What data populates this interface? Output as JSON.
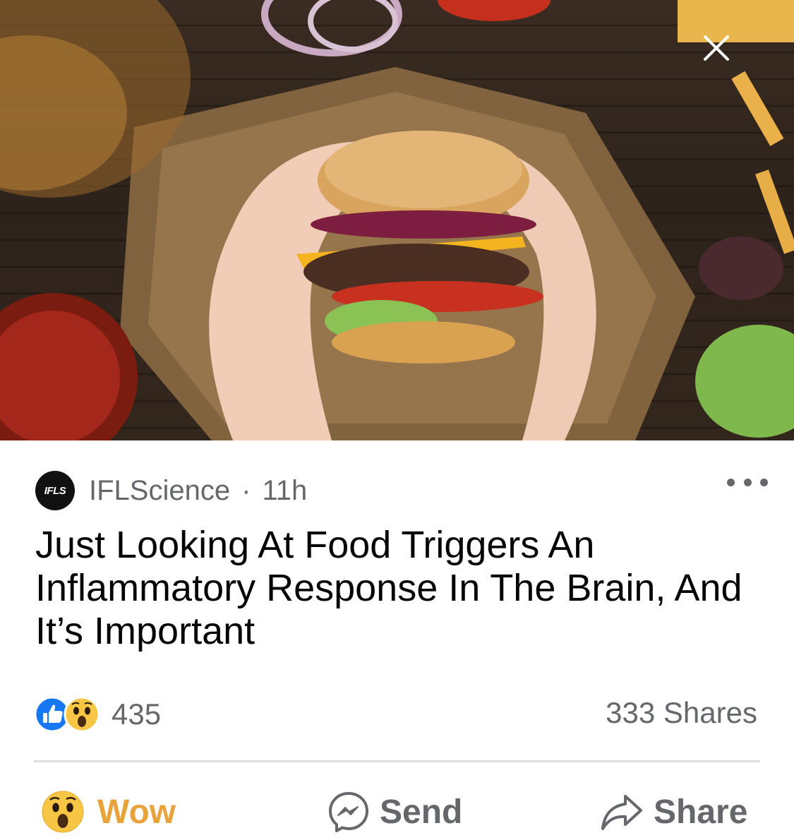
{
  "image": {
    "description": "",
    "close_icon": "close-icon"
  },
  "post": {
    "source_logo_text": "IFLS",
    "source_name": "IFLScience",
    "separator": "·",
    "time": "11h",
    "more_icon": "ellipsis-icon",
    "headline": "Just Looking At Food Triggers An Inflammatory Response In The Brain, And It’s Important"
  },
  "reactions": {
    "icons": [
      "like-reaction-icon",
      "wow-reaction-icon"
    ],
    "count": "435",
    "shares": "333 Shares"
  },
  "actions": {
    "wow_label": "Wow",
    "send_label": "Send",
    "share_label": "Share"
  },
  "colors": {
    "wow": "#e8a33c",
    "muted": "#65676b",
    "like_blue": "#1877f2"
  }
}
